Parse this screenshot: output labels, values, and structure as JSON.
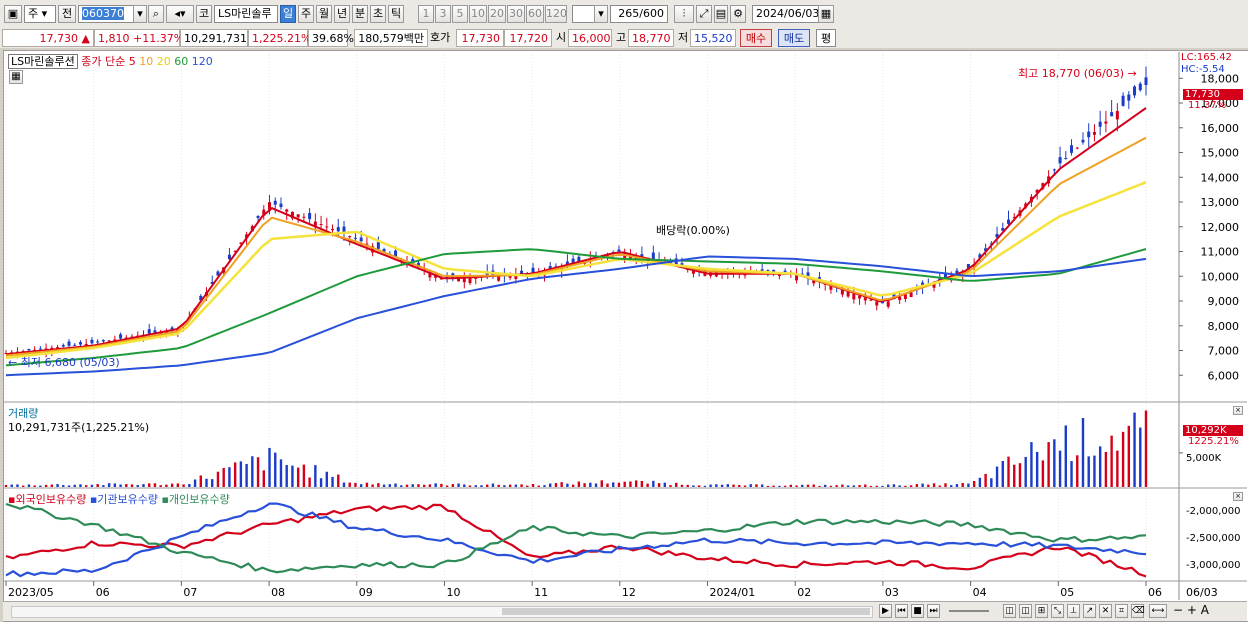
{
  "toolbar": {
    "market": "주",
    "prev_label": "전",
    "code": "060370",
    "stock_name": "LS마린솔루",
    "exchange_btn": "코",
    "periods": [
      "일",
      "주",
      "월",
      "년",
      "분",
      "초",
      "틱"
    ],
    "minute_units": [
      "1",
      "3",
      "5",
      "10",
      "20",
      "30",
      "60",
      "120"
    ],
    "count": "265",
    "count_max": "/600",
    "date": "2024/06/03"
  },
  "infobar": {
    "price": "17,730",
    "change": "1,810",
    "change_pct": "+11.37%",
    "volume": "10,291,731",
    "volume_pct": "1,225.21%",
    "turnover": "39.68%",
    "amount": "180,579백만",
    "hoga_label": "호가",
    "ask": "17,730",
    "bid": "17,720",
    "open_label": "시",
    "open": "16,000",
    "high_label": "고",
    "high": "18,770",
    "low_label": "저",
    "low": "15,520",
    "buy_btn": "매수",
    "sell_btn": "매도",
    "eval_btn": "평"
  },
  "price_panel": {
    "name_tag": "LS마린솔루션",
    "ma_prefix": "종가 단순",
    "ma_periods": [
      "5",
      "10",
      "20",
      "60",
      "120"
    ],
    "ma_colors": [
      "#d4001a",
      "#f0a020",
      "#f5e23c",
      "#1f9a3a",
      "#2850d8"
    ],
    "lc": "LC:165.42",
    "hc": "HC:-5.54",
    "current_tag": "17,730",
    "current_pct": "11.37%",
    "high_annotation": "최고 18,770 (06/03)",
    "low_annotation": "최저 6,680 (05/03)",
    "dividend_annotation": "배당락(0.00%)"
  },
  "volume_panel": {
    "title": "거래량",
    "value_text": "10,291,731주(1,225.21%)",
    "current_tag": "10,292K",
    "current_pct": "1225.21%",
    "axis_label": "5,000K"
  },
  "holders_panel": {
    "legend": [
      "외국인보유수량",
      "기관보유수량",
      "개인보유수량"
    ],
    "colors": [
      "#d4001a",
      "#2850d8",
      "#2e8b57"
    ],
    "axis_labels": [
      "-2,000,000",
      "-2,500,000",
      "-3,000,000"
    ]
  },
  "x_axis": {
    "labels": [
      "2023/05",
      "06",
      "07",
      "08",
      "09",
      "10",
      "11",
      "12",
      "2024/01",
      "02",
      "03",
      "04",
      "05",
      "06"
    ],
    "end_label": "06/03"
  },
  "chart_data": {
    "type": "line",
    "title": "",
    "price_axis": {
      "ticks": [
        6000,
        7000,
        8000,
        9000,
        10000,
        11000,
        12000,
        13000,
        14000,
        15000,
        16000,
        17000,
        18000
      ],
      "ylim": [
        5000,
        18900
      ]
    },
    "series": [
      {
        "name": "종가",
        "x": [
          "2023/05",
          "2023/06",
          "2023/07",
          "2023/08",
          "2023/09",
          "2023/10",
          "2023/11",
          "2023/12",
          "2024/01",
          "2024/02",
          "2024/03",
          "2024/04",
          "2024/05",
          "2024/06"
        ],
        "values": [
          6900,
          7300,
          7900,
          13000,
          11500,
          9900,
          10100,
          11000,
          10200,
          10100,
          8900,
          10300,
          14500,
          17730
        ]
      },
      {
        "name": "5",
        "x": [
          "2023/05",
          "2023/06",
          "2023/07",
          "2023/08",
          "2023/09",
          "2023/10",
          "2023/11",
          "2023/12",
          "2024/01",
          "2024/02",
          "2024/03",
          "2024/04",
          "2024/05",
          "2024/06"
        ],
        "values": [
          6850,
          7200,
          7900,
          12800,
          11300,
          9900,
          10100,
          11000,
          10100,
          10100,
          8950,
          10300,
          14300,
          16800
        ]
      },
      {
        "name": "10",
        "x": [
          "2023/05",
          "2023/06",
          "2023/07",
          "2023/08",
          "2023/09",
          "2023/10",
          "2023/11",
          "2023/12",
          "2024/01",
          "2024/02",
          "2024/03",
          "2024/04",
          "2024/05",
          "2024/06"
        ],
        "values": [
          6800,
          7150,
          7800,
          12400,
          11400,
          10000,
          10050,
          10900,
          10200,
          10100,
          9000,
          10200,
          13700,
          15600
        ]
      },
      {
        "name": "20",
        "x": [
          "2023/05",
          "2023/06",
          "2023/07",
          "2023/08",
          "2023/09",
          "2023/10",
          "2023/11",
          "2023/12",
          "2024/01",
          "2024/02",
          "2024/03",
          "2024/04",
          "2024/05",
          "2024/06"
        ],
        "values": [
          6700,
          7100,
          7700,
          11500,
          11800,
          10300,
          10000,
          10700,
          10300,
          10100,
          9200,
          10100,
          12400,
          13800
        ]
      },
      {
        "name": "60",
        "x": [
          "2023/05",
          "2023/06",
          "2023/07",
          "2023/08",
          "2023/09",
          "2023/10",
          "2023/11",
          "2023/12",
          "2024/01",
          "2024/02",
          "2024/03",
          "2024/04",
          "2024/05",
          "2024/06"
        ],
        "values": [
          6400,
          6700,
          7100,
          8500,
          10000,
          10900,
          11100,
          10700,
          10600,
          10500,
          10200,
          9800,
          10100,
          11100
        ]
      },
      {
        "name": "120",
        "x": [
          "2023/05",
          "2023/06",
          "2023/07",
          "2023/08",
          "2023/09",
          "2023/10",
          "2023/11",
          "2023/12",
          "2024/01",
          "2024/02",
          "2024/03",
          "2024/04",
          "2024/05",
          "2024/06"
        ],
        "values": [
          6000,
          6150,
          6400,
          6900,
          8300,
          9200,
          9900,
          10300,
          10800,
          10700,
          10400,
          10000,
          10200,
          10700
        ]
      }
    ],
    "volume_series": {
      "x": [
        "2023/05",
        "2023/06",
        "2023/07",
        "2023/08",
        "2023/09",
        "2023/10",
        "2023/11",
        "2023/12",
        "2024/01",
        "2024/02",
        "2024/03",
        "2024/04",
        "2024/05",
        "2024/06"
      ],
      "values_k": [
        400,
        500,
        600,
        5500,
        700,
        500,
        450,
        1100,
        400,
        350,
        350,
        600,
        9000,
        10292
      ]
    },
    "holder_series": [
      {
        "name": "외국인보유수량",
        "values": [
          -2850000,
          -2600000,
          -2650000,
          -2300000,
          -2050000,
          -2000000,
          -2850000,
          -2650000,
          -2850000,
          -2950000,
          -2900000,
          -3000000,
          -2650000,
          -3100000
        ]
      },
      {
        "name": "기관보유수량",
        "values": [
          -3100000,
          -3050000,
          -2500000,
          -1950000,
          -2350000,
          -2550000,
          -2900000,
          -2700000,
          -2550000,
          -2600000,
          -2600000,
          -2600000,
          -2650000,
          -2750000
        ]
      },
      {
        "name": "개인보유수량",
        "values": [
          -1950000,
          -2300000,
          -2750000,
          -3050000,
          -2950000,
          -2950000,
          -2350000,
          -2500000,
          -2400000,
          -2250000,
          -2250000,
          -2300000,
          -2550000,
          -2500000
        ]
      }
    ]
  }
}
